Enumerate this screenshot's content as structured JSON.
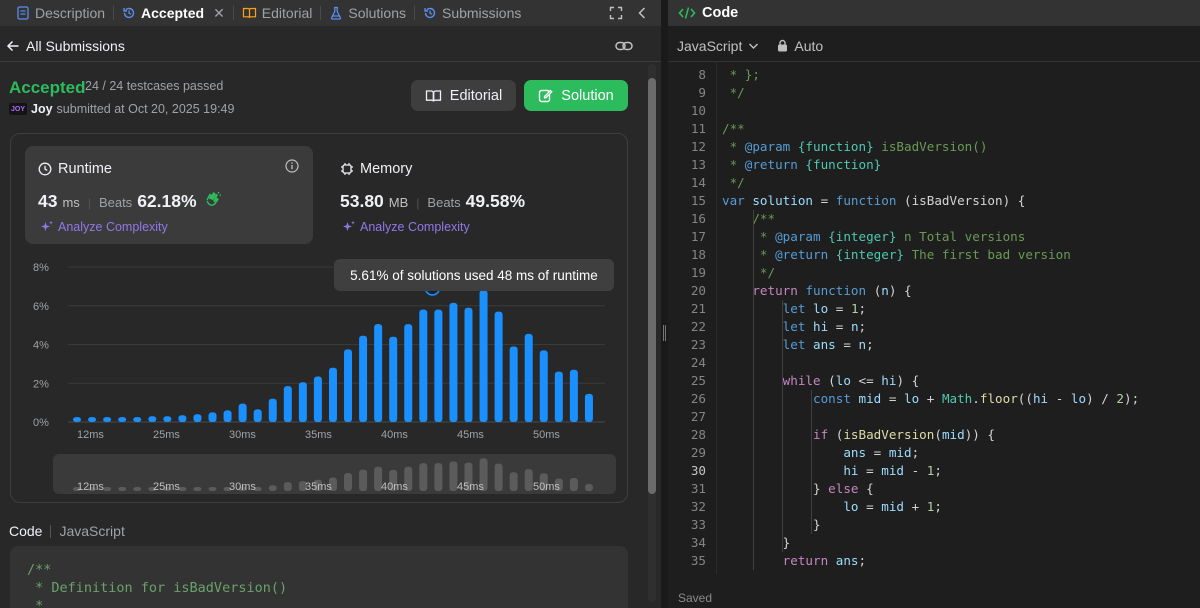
{
  "tabs": [
    {
      "label": "Description",
      "icon": "description-icon",
      "active": false
    },
    {
      "label": "Accepted",
      "icon": "history-icon",
      "active": true
    },
    {
      "label": "Editorial",
      "icon": "book-icon",
      "active": false
    },
    {
      "label": "Solutions",
      "icon": "flask-icon",
      "active": false
    },
    {
      "label": "Submissions",
      "icon": "history-icon",
      "active": false
    }
  ],
  "subheader": {
    "back_label": "All Submissions"
  },
  "submission": {
    "status": "Accepted",
    "testcases": "24 / 24 testcases passed",
    "avatar_text": "JOY",
    "user": "Joy",
    "submitted_text": "submitted at Oct 20, 2025 19:49"
  },
  "buttons": {
    "editorial": "Editorial",
    "solution": "Solution"
  },
  "runtime": {
    "title": "Runtime",
    "value": "43",
    "unit": "ms",
    "beats_label": "Beats",
    "beats": "62.18%",
    "analyze": "Analyze Complexity"
  },
  "memory": {
    "title": "Memory",
    "value": "53.80",
    "unit": "MB",
    "beats_label": "Beats",
    "beats": "49.58%",
    "analyze": "Analyze Complexity"
  },
  "tooltip": "5.61% of solutions used 48 ms of runtime",
  "chart_data": {
    "type": "bar",
    "y_ticks": [
      "8%",
      "6%",
      "4%",
      "2%",
      "0%"
    ],
    "x_ticks": [
      "12ms",
      "25ms",
      "30ms",
      "35ms",
      "40ms",
      "45ms",
      "50ms"
    ],
    "ylim": [
      0,
      8
    ],
    "values": [
      0.25,
      0.25,
      0.25,
      0.25,
      0.25,
      0.3,
      0.3,
      0.35,
      0.4,
      0.5,
      0.6,
      0.95,
      0.65,
      1.2,
      1.85,
      2.05,
      2.35,
      2.8,
      3.75,
      4.45,
      5.05,
      4.4,
      5.05,
      5.8,
      5.8,
      6.15,
      5.9,
      6.8,
      5.7,
      3.9,
      4.55,
      3.7,
      2.6,
      2.7,
      1.45
    ],
    "highlight_x": "48ms",
    "highlight_pct": "5.61%",
    "grid": true,
    "color": "#1a90ff"
  },
  "code_section": {
    "label": "Code",
    "lang": "JavaScript",
    "lines": [
      "/**",
      " * Definition for isBadVersion()",
      " *"
    ]
  },
  "editor": {
    "title": "Code",
    "language": "JavaScript",
    "mode": "Auto",
    "current_line": 30,
    "lines": [
      {
        "n": "8",
        "t": " * };"
      },
      {
        "n": "9",
        "t": " */"
      },
      {
        "n": "10",
        "t": ""
      },
      {
        "n": "11",
        "t": "/**"
      },
      {
        "n": "12",
        "t": " * @param {function} isBadVersion()"
      },
      {
        "n": "13",
        "t": " * @return {function}"
      },
      {
        "n": "14",
        "t": " */"
      },
      {
        "n": "15",
        "t": "var solution = function (isBadVersion) {"
      },
      {
        "n": "16",
        "t": "    /**"
      },
      {
        "n": "17",
        "t": "     * @param {integer} n Total versions"
      },
      {
        "n": "18",
        "t": "     * @return {integer} The first bad version"
      },
      {
        "n": "19",
        "t": "     */"
      },
      {
        "n": "20",
        "t": "    return function (n) {"
      },
      {
        "n": "21",
        "t": "        let lo = 1;"
      },
      {
        "n": "22",
        "t": "        let hi = n;"
      },
      {
        "n": "23",
        "t": "        let ans = n;"
      },
      {
        "n": "24",
        "t": ""
      },
      {
        "n": "25",
        "t": "        while (lo <= hi) {"
      },
      {
        "n": "26",
        "t": "            const mid = lo + Math.floor((hi - lo) / 2);"
      },
      {
        "n": "27",
        "t": ""
      },
      {
        "n": "28",
        "t": "            if (isBadVersion(mid)) {"
      },
      {
        "n": "29",
        "t": "                ans = mid;"
      },
      {
        "n": "30",
        "t": "                hi = mid - 1;"
      },
      {
        "n": "31",
        "t": "            } else {"
      },
      {
        "n": "32",
        "t": "                lo = mid + 1;"
      },
      {
        "n": "33",
        "t": "            }"
      },
      {
        "n": "34",
        "t": "        }"
      },
      {
        "n": "35",
        "t": "        return ans;"
      }
    ]
  },
  "footer_status": "Saved",
  "colors": {
    "accent_green": "#2cbb5d",
    "bar_blue": "#1a90ff",
    "analyze_purple": "#8f79e8"
  }
}
